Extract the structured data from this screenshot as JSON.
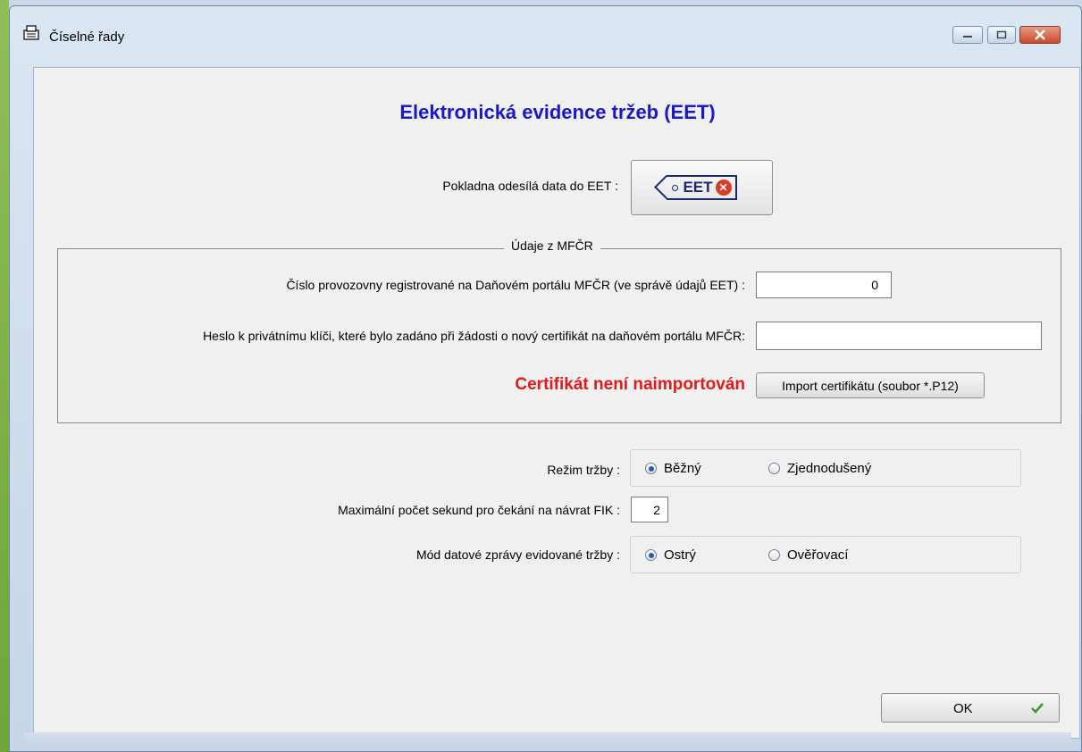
{
  "window": {
    "title": "Číselné řady"
  },
  "form": {
    "heading": "Elektronická evidence tržeb (EET)",
    "send_label": "Pokladna odesílá data do EET :",
    "eet_logo_text": "EET",
    "group_title": "Údaje z MFČR",
    "establishment_label": "Číslo provozovny registrované na Daňovém portálu MFČR (ve správě údajů EET) :",
    "establishment_value": "0",
    "password_label": "Heslo k privátnímu klíči, které bylo zadáno při žádosti o nový certifikát na daňovém portálu MFČR:",
    "password_value": "",
    "cert_status": "Certifikát není naimportován",
    "import_button": "Import certifikátu (soubor *.P12)",
    "mode_label": "Režim tržby :",
    "mode_options": [
      {
        "label": "Běžný",
        "selected": true
      },
      {
        "label": "Zjednodušený",
        "selected": false
      }
    ],
    "fik_label": "Maximální počet sekund pro čekání na návrat FIK :",
    "fik_value": "2",
    "msg_mode_label": "Mód datové zprávy evidované tržby :",
    "msg_mode_options": [
      {
        "label": "Ostrý",
        "selected": true
      },
      {
        "label": "Ověřovací",
        "selected": false
      }
    ],
    "ok_button": "OK"
  },
  "colors": {
    "heading": "#1919c8",
    "error": "#e01b1b",
    "accent": "#1f5fa6"
  },
  "icons": {
    "title": "cash-register-icon",
    "ok": "checkmark-icon",
    "eet": "eet-logo"
  }
}
